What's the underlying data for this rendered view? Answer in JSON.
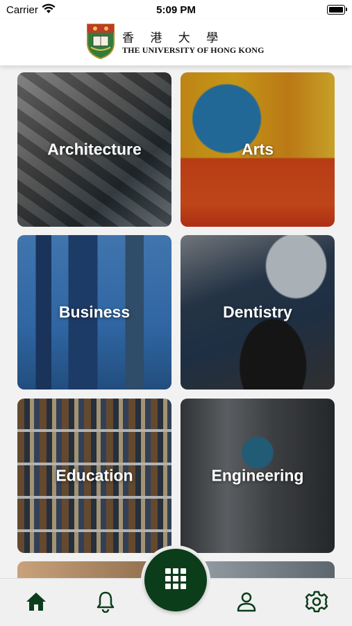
{
  "status_bar": {
    "carrier": "Carrier",
    "time": "5:09 PM"
  },
  "header": {
    "name_chinese": "香 港 大 學",
    "name_english": "THE UNIVERSITY OF HONG KONG",
    "crest_icon": "hku-crest-icon"
  },
  "faculties": [
    {
      "label": "Architecture"
    },
    {
      "label": "Arts"
    },
    {
      "label": "Business"
    },
    {
      "label": "Dentistry"
    },
    {
      "label": "Education"
    },
    {
      "label": "Engineering"
    }
  ],
  "tab_bar": {
    "icons": [
      "home-icon",
      "bell-icon",
      "grid-icon",
      "user-icon",
      "gear-icon"
    ],
    "accent_color": "#0b3d1a"
  }
}
